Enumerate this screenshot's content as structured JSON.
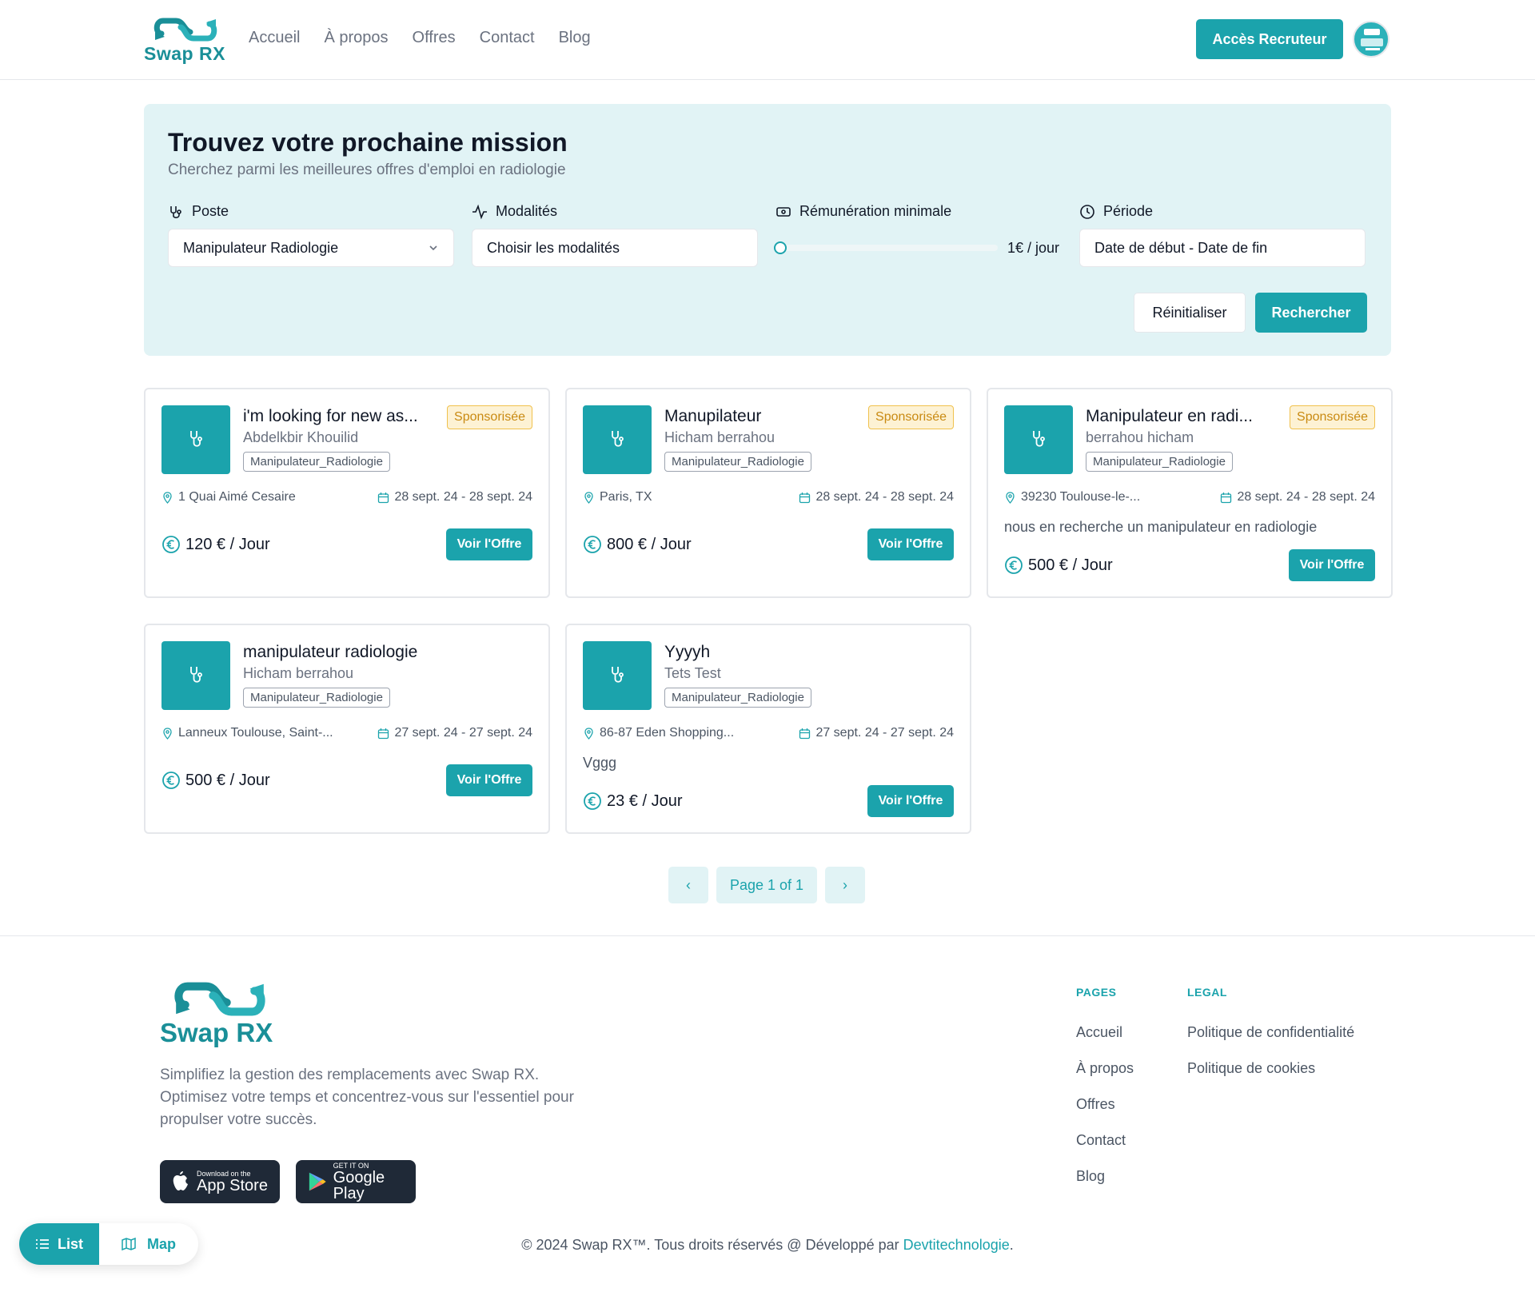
{
  "header": {
    "logo_text": "Swap RX",
    "nav": [
      "Accueil",
      "À propos",
      "Offres",
      "Contact",
      "Blog"
    ],
    "recruiter_button": "Accès Recruteur"
  },
  "search": {
    "title": "Trouvez votre prochaine mission",
    "subtitle": "Cherchez parmi les meilleures offres d'emploi en radiologie",
    "poste_label": "Poste",
    "poste_value": "Manipulateur Radiologie",
    "modalites_label": "Modalités",
    "modalites_placeholder": "Choisir les modalités",
    "remuneration_label": "Rémunération minimale",
    "remuneration_value": "1€ / jour",
    "remuneration_level": 0,
    "periode_label": "Période",
    "periode_placeholder": "Date de début - Date de fin",
    "reset_button": "Réinitialiser",
    "search_button": "Rechercher"
  },
  "offers": [
    {
      "title": "i'm looking for new as...",
      "company": "Abdelkbir Khouilid",
      "tag": "Manipulateur_Radiologie",
      "badge": "Sponsorisée",
      "location": "1 Quai Aimé Cesaire",
      "dates": "28 sept. 24 - 28 sept. 24",
      "description": "",
      "price": "120 € / Jour",
      "button": "Voir l'Offre"
    },
    {
      "title": "Manupilateur",
      "company": "Hicham berrahou",
      "tag": "Manipulateur_Radiologie",
      "badge": "Sponsorisée",
      "location": "Paris, TX",
      "dates": "28 sept. 24 - 28 sept. 24",
      "description": "",
      "price": "800 € / Jour",
      "button": "Voir l'Offre"
    },
    {
      "title": "Manipulateur en radi...",
      "company": "berrahou hicham",
      "tag": "Manipulateur_Radiologie",
      "badge": "Sponsorisée",
      "location": "39230 Toulouse-le-...",
      "dates": "28 sept. 24 - 28 sept. 24",
      "description": "nous en recherche un manipulateur en radiologie",
      "price": "500 € / Jour",
      "button": "Voir l'Offre"
    },
    {
      "title": "manipulateur radiologie",
      "company": "Hicham berrahou",
      "tag": "Manipulateur_Radiologie",
      "badge": "",
      "location": "Lanneux Toulouse, Saint-...",
      "dates": "27 sept. 24 - 27 sept. 24",
      "description": "",
      "price": "500 € / Jour",
      "button": "Voir l'Offre"
    },
    {
      "title": "Yyyyh",
      "company": "Tets Test",
      "tag": "Manipulateur_Radiologie",
      "badge": "",
      "location": "86-87 Eden Shopping...",
      "dates": "27 sept. 24 - 27 sept. 24",
      "description": "Vggg",
      "price": "23 € / Jour",
      "button": "Voir l'Offre"
    }
  ],
  "pagination": {
    "prev": "‹",
    "label": "Page 1 of 1",
    "next": "›"
  },
  "footer": {
    "logo_text": "Swap RX",
    "description": "Simplifiez la gestion des remplacements avec Swap RX. Optimisez votre temps et concentrez-vous sur l'essentiel pour propulser votre succès.",
    "app_store_small": "Download on the",
    "app_store_big": "App Store",
    "google_play_small": "GET IT ON",
    "google_play_big": "Google Play",
    "pages_title": "PAGES",
    "pages_links": [
      "Accueil",
      "À propos",
      "Offres",
      "Contact",
      "Blog"
    ],
    "legal_title": "LEGAL",
    "legal_links": [
      "Politique de confidentialité",
      "Politique de cookies"
    ],
    "copyright": "© 2024 Swap RX™. Tous droits réservés @ Développé par ",
    "developer": "Devtitechnologie",
    "copyright_end": "."
  },
  "view_toggle": {
    "list": "List",
    "map": "Map"
  },
  "colors": {
    "accent": "#1ba3ac",
    "panel": "#e1f3f5",
    "badge_bg": "#fdf2d4",
    "badge_text": "#c98a12"
  }
}
